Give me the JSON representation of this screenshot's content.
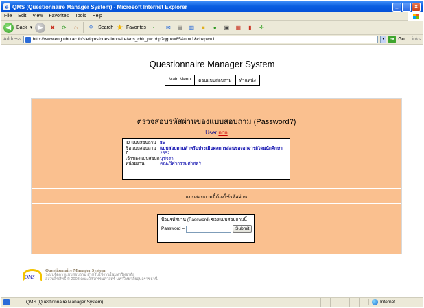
{
  "window": {
    "title": "QMS (Questionnaire Manager System) - Microsoft Internet Explorer"
  },
  "menu": [
    "File",
    "Edit",
    "View",
    "Favorites",
    "Tools",
    "Help"
  ],
  "toolbar": {
    "back_label": "Back",
    "search_label": "Search",
    "favorites_label": "Favorites"
  },
  "address": {
    "label": "Address",
    "url": "http://www.eng.ubu.ac.th/~ie/qms/questionnaire/ans_chk_pw.php?qgno=85&no=1&chkpw=1",
    "go_label": "Go",
    "links_label": "Links"
  },
  "page": {
    "title": "Questionnaire Manager System",
    "nav": [
      "Main Menu",
      "ตอบแบบสอบถาม",
      "ทำแหน่ง"
    ],
    "heading": "ตรวจสอบรหัสผ่านของแบบสอบถาม (Password?)",
    "user_label": "User",
    "user_name": "nnn",
    "info": {
      "rows": [
        {
          "key": "ID แบบสอบถาม",
          "value": "85",
          "bold": true
        },
        {
          "key": "ชื่อแบบสอบถาม",
          "value": "แบบสอบถามสำหรับประเมินผลการสอนของอาจารย์โดยนักศึกษา",
          "bold": true
        },
        {
          "key": "ปี",
          "value": "2552",
          "bold": false
        },
        {
          "key": "เจ้าของแบบสอบถาม",
          "value": "นุชจรา",
          "bold": false
        },
        {
          "key": "หน่วยงาน",
          "value": "คณะวิศวกรรมศาสตร์",
          "bold": false
        }
      ]
    },
    "section_label": "แบบสอบถามนี้ต้องใช้รหัสผ่าน",
    "password": {
      "instruction": "ป้อนรหัสผ่าน (Password) ของแบบสอบถามนี้",
      "label": "Password =",
      "value": "",
      "submit_label": "Submit"
    },
    "footer": {
      "logo_text": "QMS",
      "title": "Questionnaire Manager System",
      "line1": "ระบบจัดการแบบสอบถาม สำหรับใช้งานในมหาวิทยาลัย",
      "line2": "สงวนลิขสิทธิ์ © 2008 คณะวิศวกรรมศาสตร์ มหาวิทยาลัยอุบลราชธานี"
    }
  },
  "status": {
    "text": "QMS (Questionnaire Manager System)",
    "zone": "Internet"
  }
}
